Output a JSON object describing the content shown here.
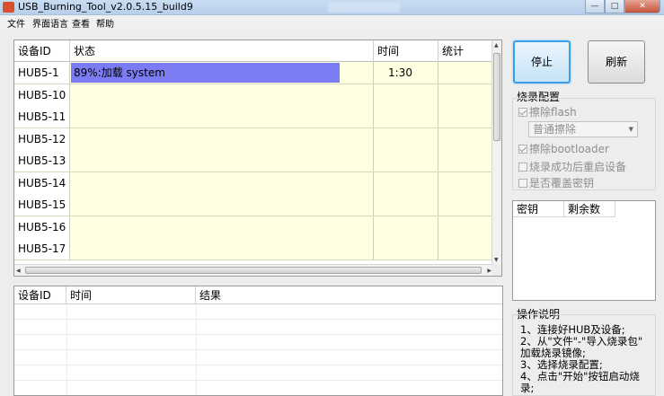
{
  "window": {
    "title": "USB_Burning_Tool_v2.0.5.15_build9"
  },
  "menu": [
    "文件",
    "界面语言",
    "查看",
    "帮助"
  ],
  "grid": {
    "columns": [
      "设备ID",
      "状态",
      "时间",
      "统计"
    ],
    "rows": [
      {
        "id": "HUB5-1",
        "status": "89%:加载 system",
        "progress": 0.89,
        "time": "1:30",
        "stat": ""
      },
      {
        "id": "HUB5-10",
        "status": "",
        "time": "",
        "stat": ""
      },
      {
        "id": "HUB5-11",
        "status": "",
        "time": "",
        "stat": ""
      },
      {
        "id": "HUB5-12",
        "status": "",
        "time": "",
        "stat": ""
      },
      {
        "id": "HUB5-13",
        "status": "",
        "time": "",
        "stat": ""
      },
      {
        "id": "HUB5-14",
        "status": "",
        "time": "",
        "stat": ""
      },
      {
        "id": "HUB5-15",
        "status": "",
        "time": "",
        "stat": ""
      },
      {
        "id": "HUB5-16",
        "status": "",
        "time": "",
        "stat": ""
      },
      {
        "id": "HUB5-17",
        "status": "",
        "time": "",
        "stat": ""
      }
    ]
  },
  "log": {
    "columns": [
      "设备ID",
      "时间",
      "结果"
    ]
  },
  "buttons": {
    "stop": "停止",
    "refresh": "刷新"
  },
  "config": {
    "title": "烧录配置",
    "erase_flash": "擦除flash",
    "erase_mode": "普通擦除",
    "erase_bootloader": "擦除bootloader",
    "reboot_after": "烧录成功后重启设备",
    "overwrite_key": "是否覆盖密钥"
  },
  "keys": {
    "columns": [
      "密钥",
      "剩余数"
    ]
  },
  "help": {
    "title": "操作说明",
    "lines": [
      "1、连接好HUB及设备;",
      "2、从\"文件\"-\"导入烧录包\"",
      "加载烧录镜像;",
      "3、选择烧录配置;",
      "4、点击\"开始\"按钮启动烧",
      "录;"
    ]
  },
  "colors": {
    "progress": "#7c7cf2",
    "row_bg": "#ffffe1",
    "focus_border": "#3c9ee6"
  }
}
